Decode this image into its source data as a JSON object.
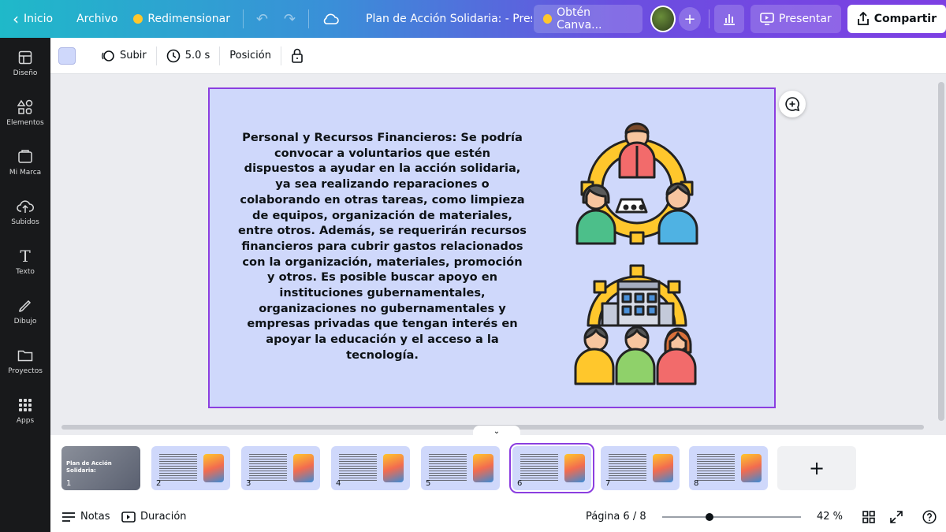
{
  "topbar": {
    "back_label": "Inicio",
    "file_label": "Archivo",
    "resize_label": "Redimensionar",
    "doc_title": "Plan de Acción Solidaria: - Present...",
    "upgrade_label": "Obtén Canva...",
    "present_label": "Presentar",
    "share_label": "Compartir"
  },
  "sidebar": {
    "items": [
      {
        "label": "Diseño",
        "icon": "layout-icon"
      },
      {
        "label": "Elementos",
        "icon": "shapes-icon"
      },
      {
        "label": "Mi Marca",
        "icon": "brand-icon"
      },
      {
        "label": "Subidos",
        "icon": "upload-icon"
      },
      {
        "label": "Texto",
        "icon": "text-icon"
      },
      {
        "label": "Dibujo",
        "icon": "draw-icon"
      },
      {
        "label": "Proyectos",
        "icon": "folder-icon"
      },
      {
        "label": "Apps",
        "icon": "apps-icon"
      }
    ]
  },
  "toolbar": {
    "background_color": "#cfd8fb",
    "animate_label": "Subir",
    "duration_label": "5.0 s",
    "position_label": "Posición"
  },
  "slide": {
    "body_text": "Personal y Recursos Financieros: Se podría convocar a voluntarios que estén dispuestos a ayudar en la acción solidaria, ya sea realizando reparaciones o colaborando en otras tareas, como limpieza de equipos, organización de materiales, entre otros. Además, se requerirán recursos financieros para cubrir gastos relacionados con la organización, materiales, promoción y otros. Es posible buscar apoyo en instituciones gubernamentales, organizaciones no gubernamentales y empresas privadas que tengan interés en apoyar la educación y el acceso a la tecnología.",
    "image_top": "team-gear-icon",
    "image_bottom": "company-team-icon"
  },
  "filmstrip": {
    "pages": [
      {
        "num": "1",
        "title": "Plan de Acción Solidaria:"
      },
      {
        "num": "2"
      },
      {
        "num": "3"
      },
      {
        "num": "4"
      },
      {
        "num": "5"
      },
      {
        "num": "6"
      },
      {
        "num": "7"
      },
      {
        "num": "8"
      }
    ],
    "active_page": 6
  },
  "bottombar": {
    "notes_label": "Notas",
    "duration_label": "Duración",
    "page_indicator": "Página 6 / 8",
    "zoom_label": "42 %",
    "zoom_fraction": 0.34
  },
  "colors": {
    "accent": "#8b3ee0",
    "slide_bg": "#cfd8fb",
    "sidebar_bg": "#18191b"
  }
}
